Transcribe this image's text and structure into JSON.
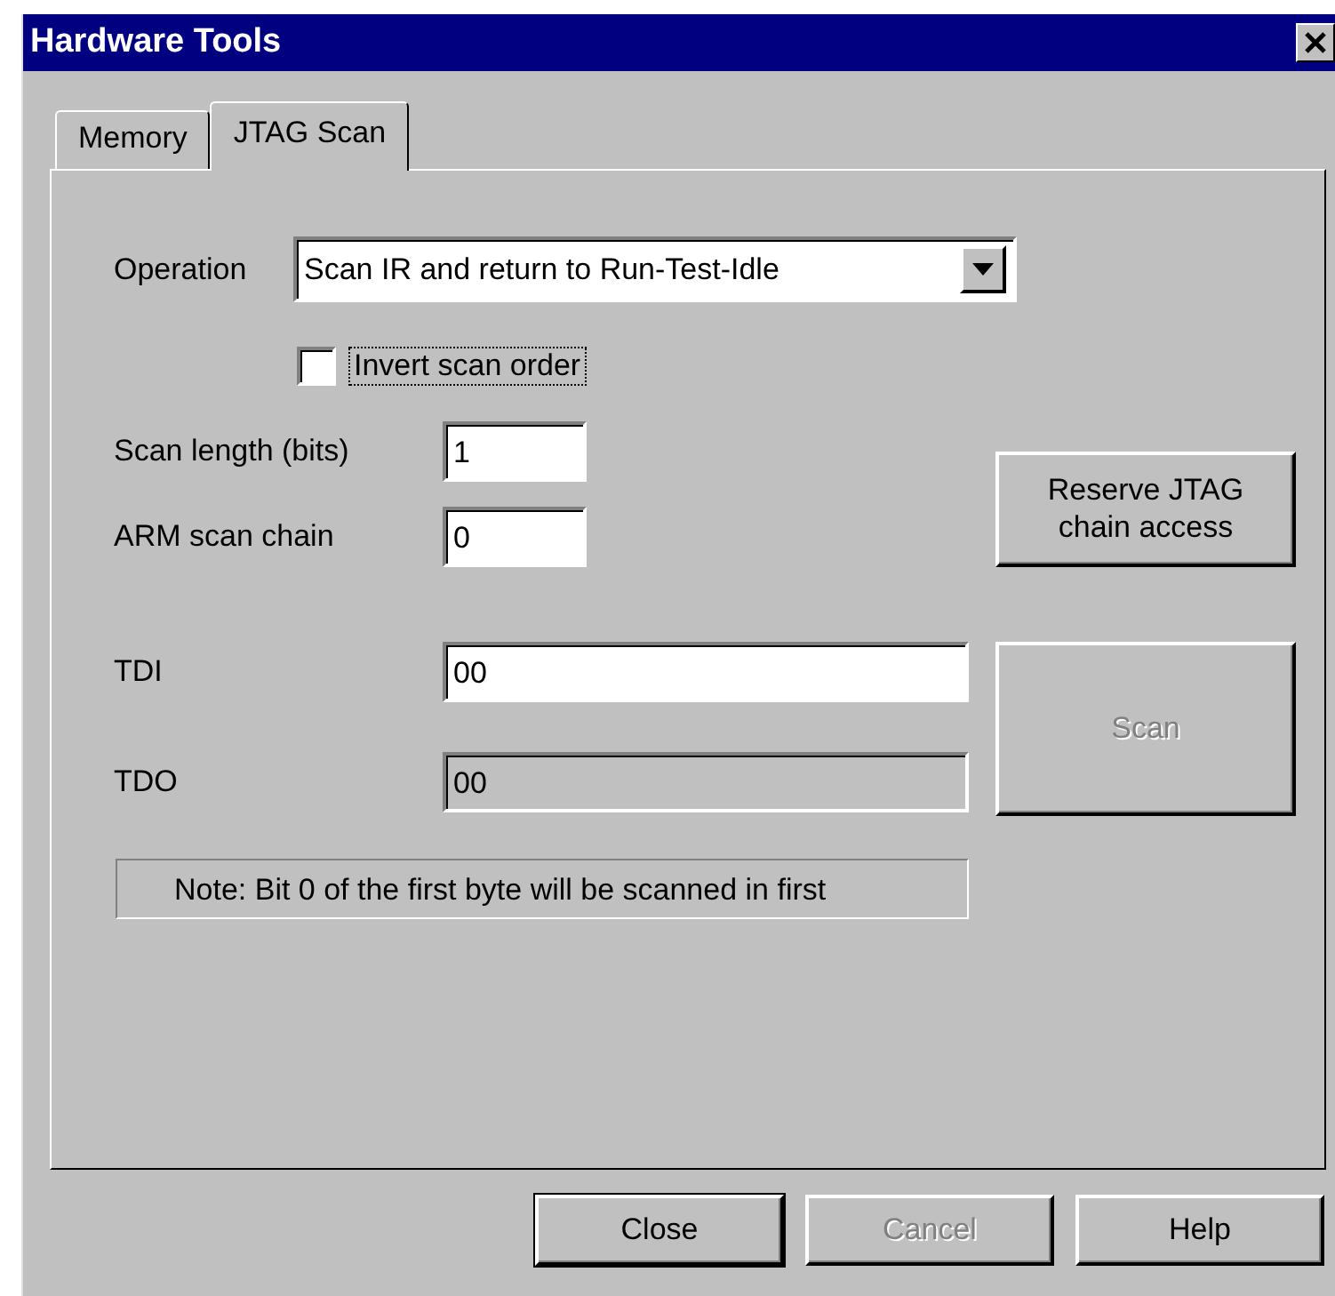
{
  "window": {
    "title": "Hardware Tools"
  },
  "tabs": [
    {
      "label": "Memory",
      "selected": false
    },
    {
      "label": "JTAG Scan",
      "selected": true
    }
  ],
  "operation": {
    "label": "Operation",
    "value": "Scan IR and return to Run-Test-Idle"
  },
  "invert_scan_order": {
    "label": "Invert scan order",
    "checked": false,
    "focused": true
  },
  "fields": [
    {
      "label": "Scan length (bits)",
      "value": "1",
      "disabled": false
    },
    {
      "label": "ARM scan chain",
      "value": "0",
      "disabled": false
    }
  ],
  "reserve_button": {
    "label": "Reserve JTAG chain access",
    "disabled": false
  },
  "data_fields": [
    {
      "label": "TDI",
      "value": "00",
      "disabled": false
    },
    {
      "label": "TDO",
      "value": "00",
      "disabled": true
    }
  ],
  "scan_button": {
    "label": "Scan",
    "disabled": true
  },
  "note": "Note: Bit 0 of the first byte will be scanned in first",
  "buttons": [
    {
      "label": "Close",
      "disabled": false,
      "default": true
    },
    {
      "label": "Cancel",
      "disabled": true,
      "default": false
    },
    {
      "label": "Help",
      "disabled": false,
      "default": false
    }
  ]
}
